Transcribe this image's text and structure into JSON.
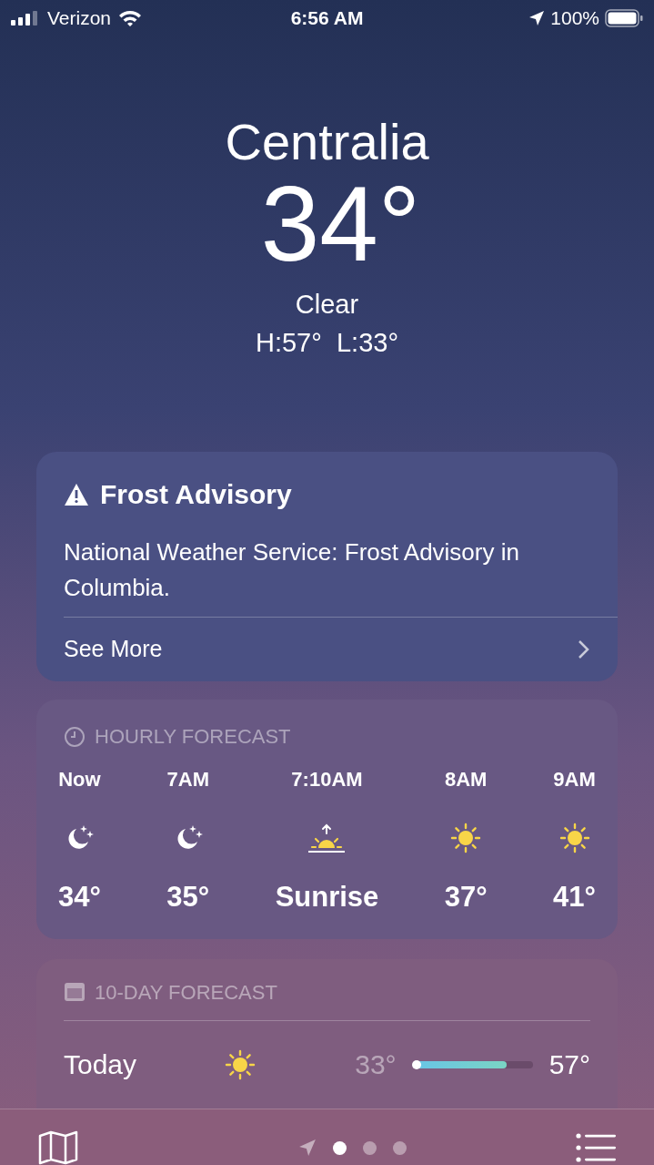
{
  "status_bar": {
    "carrier": "Verizon",
    "time": "6:56 AM",
    "battery": "100%"
  },
  "current": {
    "city": "Centralia",
    "temperature": "34°",
    "condition": "Clear",
    "high_low": "H:57°  L:33°"
  },
  "alert": {
    "title": "Frost Advisory",
    "body": "National Weather Service: Frost Advisory in Columbia.",
    "link": "See More"
  },
  "hourly": {
    "title": "HOURLY FORECAST",
    "items": [
      {
        "time": "Now",
        "kind": "moon",
        "value": "34°"
      },
      {
        "time": "7AM",
        "kind": "moon",
        "value": "35°"
      },
      {
        "time": "7:10AM",
        "kind": "sunrise",
        "value": "Sunrise"
      },
      {
        "time": "8AM",
        "kind": "sun",
        "value": "37°"
      },
      {
        "time": "9AM",
        "kind": "sun",
        "value": "41°"
      }
    ]
  },
  "ten_day": {
    "title": "10-DAY FORECAST",
    "days": [
      {
        "day": "Today",
        "kind": "sun",
        "low": "33°",
        "high": "57°",
        "level": 0.78
      }
    ]
  },
  "tab_bar": {
    "pages": [
      {
        "selected": true
      },
      {
        "selected": false
      },
      {
        "selected": false
      }
    ]
  }
}
